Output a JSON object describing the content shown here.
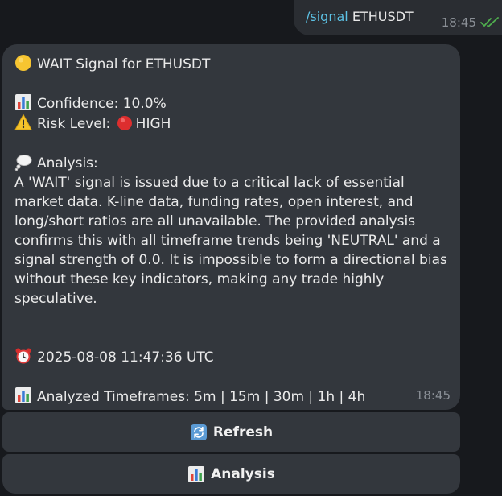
{
  "outgoing": {
    "command": "/signal",
    "symbol": "ETHUSDT",
    "time": "18:45"
  },
  "incoming": {
    "title": "WAIT Signal for ETHUSDT",
    "confidence": "Confidence: 10.0%",
    "risk_prefix": "Risk Level:",
    "risk_value": "HIGH",
    "analysis_heading": "Analysis:",
    "analysis_text": "A 'WAIT' signal is issued due to a critical lack of essential market data. K-line data, funding rates, open interest, and long/short ratios are all unavailable. The provided analysis confirms this with all timeframe trends being 'NEUTRAL' and a signal strength of 0.0. It is impossible to form a directional bias without these key indicators, making any trade highly speculative.",
    "timestamp": "2025-08-08 11:47:36 UTC",
    "timeframes": "Analyzed Timeframes: 5m | 15m | 30m | 1h | 4h",
    "time": "18:45"
  },
  "buttons": {
    "refresh_label": "Refresh",
    "analysis_label": "Analysis"
  },
  "icons": {
    "status": "yellow-circle-icon",
    "chart": "bar-chart-icon",
    "warning": "warning-icon",
    "risk": "red-circle-icon",
    "analysis": "thought-bubble-icon",
    "clock": "alarm-clock-icon",
    "refresh": "refresh-icon",
    "read": "double-check-icon"
  },
  "colors": {
    "background": "#17191d",
    "bubble": "#33373d",
    "command_link": "#5dc3e6",
    "read_check": "#4fae4e"
  }
}
